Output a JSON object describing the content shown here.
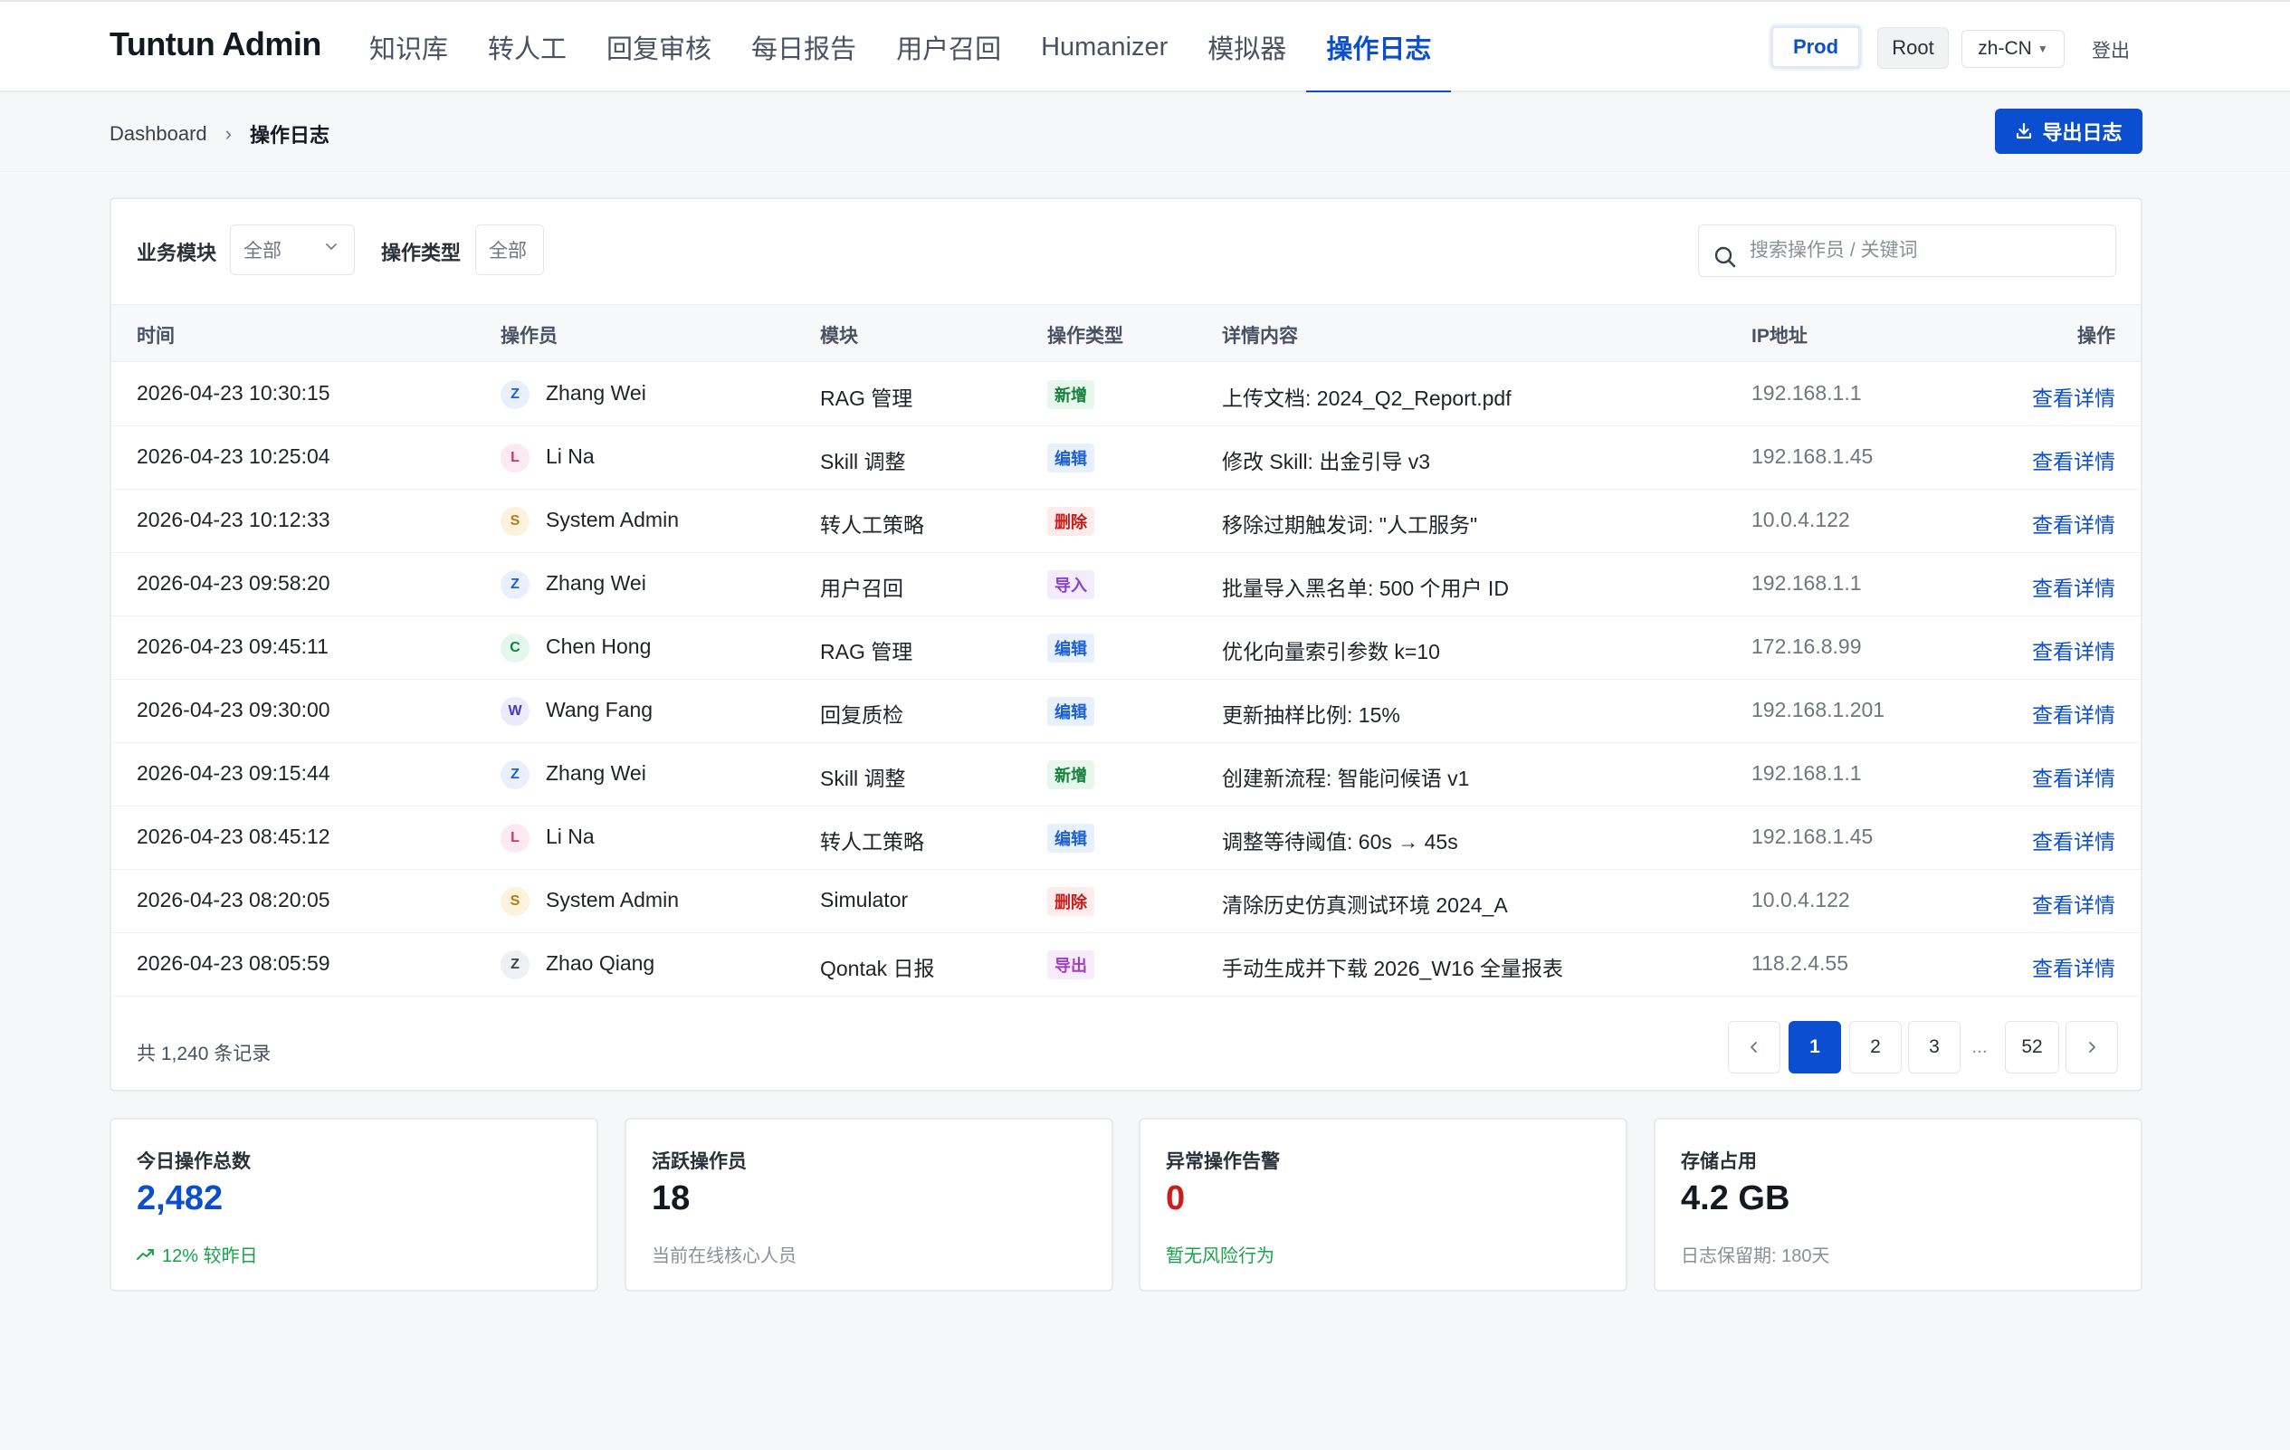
{
  "app": {
    "brand": "Tuntun Admin"
  },
  "nav": {
    "items": [
      {
        "label": "知识库"
      },
      {
        "label": "转人工"
      },
      {
        "label": "回复审核"
      },
      {
        "label": "每日报告"
      },
      {
        "label": "用户召回"
      },
      {
        "label": "Humanizer"
      },
      {
        "label": "模拟器"
      },
      {
        "label": "操作日志",
        "active": true
      }
    ],
    "env": "Prod",
    "role": "Root",
    "lang": "zh-CN",
    "logout": "登出"
  },
  "breadcrumb": {
    "home": "Dashboard",
    "separator": "›",
    "current": "操作日志"
  },
  "toolbar": {
    "export_label": "导出日志"
  },
  "filters": {
    "module_label": "业务模块",
    "module_value": "全部",
    "type_label": "操作类型",
    "type_value": "全部",
    "search_placeholder": "搜索操作员 / 关键词"
  },
  "table": {
    "headers": {
      "time": "时间",
      "operator": "操作员",
      "module": "模块",
      "type": "操作类型",
      "detail": "详情内容",
      "ip": "IP地址",
      "action": "操作"
    },
    "rows": [
      {
        "time": "2026-04-23 10:30:15",
        "initial": "Z",
        "operator": "Zhang Wei",
        "module": "RAG 管理",
        "type": "新增",
        "detail": "上传文档: 2024_Q2_Report.pdf",
        "ip": "192.168.1.1",
        "action": "查看详情"
      },
      {
        "time": "2026-04-23 10:25:04",
        "initial": "L",
        "operator": "Li Na",
        "module": "Skill 调整",
        "type": "编辑",
        "detail": "修改 Skill: 出金引导 v3",
        "ip": "192.168.1.45",
        "action": "查看详情"
      },
      {
        "time": "2026-04-23 10:12:33",
        "initial": "S",
        "operator": "System Admin",
        "module": "转人工策略",
        "type": "删除",
        "detail": "移除过期触发词: \"人工服务\"",
        "ip": "10.0.4.122",
        "action": "查看详情"
      },
      {
        "time": "2026-04-23 09:58:20",
        "initial": "Z",
        "operator": "Zhang Wei",
        "module": "用户召回",
        "type": "导入",
        "detail": "批量导入黑名单: 500 个用户 ID",
        "ip": "192.168.1.1",
        "action": "查看详情"
      },
      {
        "time": "2026-04-23 09:45:11",
        "initial": "C",
        "operator": "Chen Hong",
        "module": "RAG 管理",
        "type": "编辑",
        "detail": "优化向量索引参数 k=10",
        "ip": "172.16.8.99",
        "action": "查看详情"
      },
      {
        "time": "2026-04-23 09:30:00",
        "initial": "W",
        "operator": "Wang Fang",
        "module": "回复质检",
        "type": "编辑",
        "detail": "更新抽样比例: 15%",
        "ip": "192.168.1.201",
        "action": "查看详情"
      },
      {
        "time": "2026-04-23 09:15:44",
        "initial": "Z",
        "operator": "Zhang Wei",
        "module": "Skill 调整",
        "type": "新增",
        "detail": "创建新流程: 智能问候语 v1",
        "ip": "192.168.1.1",
        "action": "查看详情"
      },
      {
        "time": "2026-04-23 08:45:12",
        "initial": "L",
        "operator": "Li Na",
        "module": "转人工策略",
        "type": "编辑",
        "detail": "调整等待阈值: 60s → 45s",
        "ip": "192.168.1.45",
        "action": "查看详情"
      },
      {
        "time": "2026-04-23 08:20:05",
        "initial": "S",
        "operator": "System Admin",
        "module": "Simulator",
        "type": "删除",
        "detail": "清除历史仿真测试环境 2024_A",
        "ip": "10.0.4.122",
        "action": "查看详情"
      },
      {
        "time": "2026-04-23 08:05:59",
        "initial": "Z",
        "operator": "Zhao Qiang",
        "module": "Qontak 日报",
        "type": "导出",
        "detail": "手动生成并下载 2026_W16 全量报表",
        "ip": "118.2.4.55",
        "action": "查看详情"
      }
    ]
  },
  "pagination": {
    "total": "共 1,240 条记录",
    "pages": [
      "1",
      "2",
      "3"
    ],
    "ellipsis": "...",
    "last": "52",
    "current": "1"
  },
  "stats": [
    {
      "label": "今日操作总数",
      "value": "2,482",
      "sub": "12% 较昨日",
      "value_color": "#0b4fd0",
      "sub_tone": "green",
      "sub_icon": "trend-up-icon"
    },
    {
      "label": "活跃操作员",
      "value": "18",
      "sub": "当前在线核心人员",
      "value_color": "#141821",
      "sub_tone": "gray"
    },
    {
      "label": "异常操作告警",
      "value": "0",
      "sub": "暂无风险行为",
      "value_color": "#c81e1e",
      "sub_tone": "green"
    },
    {
      "label": "存储占用",
      "value": "4.2 GB",
      "sub": "日志保留期: 180天",
      "value_color": "#141821",
      "sub_tone": "gray"
    }
  ],
  "colors": {
    "accent": "#0b4fd0",
    "tag_new": {
      "bg": "#e8f7ee",
      "fg": "#15803d"
    },
    "tag_edit": {
      "bg": "#e8f0fd",
      "fg": "#1d5fd6"
    },
    "tag_delete": {
      "bg": "#fdecec",
      "fg": "#c81e1e"
    },
    "tag_import": {
      "bg": "#f3ecfd",
      "fg": "#8b3fd9"
    },
    "tag_export": {
      "bg": "#f7ecfb",
      "fg": "#a53cc8"
    }
  }
}
